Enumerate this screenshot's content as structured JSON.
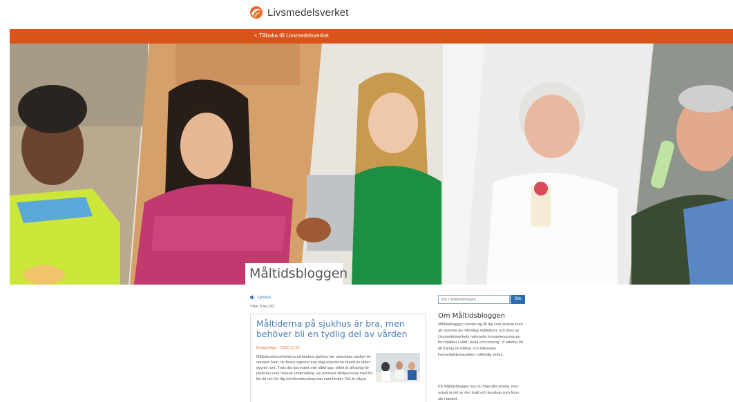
{
  "header": {
    "brand_name": "Livsmedelsverket",
    "accent_color": "#d9541a"
  },
  "nav": {
    "back_link": "< Tillbaka till Livsmedelsverket"
  },
  "hero": {
    "blog_title": "Måltidsbloggen"
  },
  "content": {
    "listen_label": "Lyssna",
    "count_label": "Visar 5 av 132",
    "post": {
      "title": "Måltiderna på sjukhus är bra, men behöver bli en tydlig del av vården",
      "meta": "Blogginlägg – 2022-11-23",
      "excerpt": "Måltidsverksamheterna på landets sjukhus har utvecklats positivt de senaste åren, de flesta regioner kan idag erbjuda en bredd av rätter dygnet runt. Trots det äts maten inte alltid upp, vilket är allvarligt för patienter som riskerar undernäring. En pressad vårdpersonal med för lite tid och för låg nutritionskunskap kan vara hinder. Det är några"
    }
  },
  "sidebar": {
    "search_placeholder": "Sök i Måltidsbloggen",
    "search_button": "Sök",
    "about_title": "Om Måltidsbloggen",
    "about_text_1": "Måltidsbloggen vänder sig till dig som arbetar med att utveckla de offentliga måltiderna och drivs av Livsmedelsverkets nationella kompetenscentrum för måltider i vård, skola och omsorg. Vi arbetar för att främja en hållbar och hälsosam livsmedelskonsumtion i offentlig sektor.",
    "about_text_2": "På Måltidsbloggen kan du följa vårt arbete, men också ta del av den kraft och kunskap som finns ute i landet!"
  }
}
